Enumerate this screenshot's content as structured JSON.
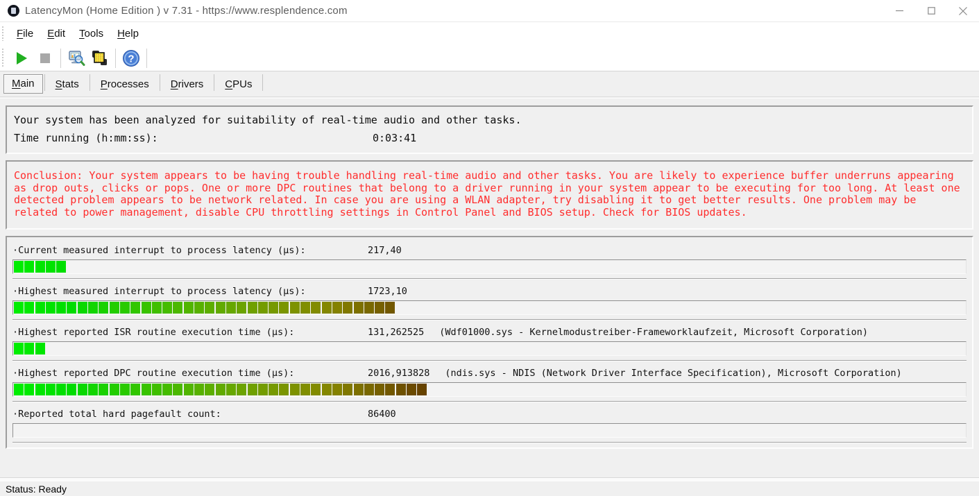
{
  "window": {
    "title": "LatencyMon  (Home Edition )  v 7.31 - https://www.resplendence.com",
    "controls": {
      "minimize": "minimize",
      "maximize": "maximize",
      "close": "close"
    }
  },
  "menu": {
    "items": [
      "File",
      "Edit",
      "Tools",
      "Help"
    ]
  },
  "toolbar": {
    "icons": [
      "play-icon",
      "stop-icon",
      "system-report-icon",
      "layered-windows-icon",
      "help-icon"
    ]
  },
  "tabs": {
    "items": [
      "Main",
      "Stats",
      "Processes",
      "Drivers",
      "CPUs"
    ],
    "active": "Main"
  },
  "analysis": {
    "headline": "Your system has been analyzed for suitability of real-time audio and other tasks.",
    "time_label": "Time running (h:mm:ss):",
    "time_value": "0:03:41"
  },
  "conclusion": "Conclusion: Your system appears to be having trouble handling real-time audio and other tasks. You are likely to experience buffer underruns appearing as drop outs, clicks or pops. One or more DPC routines that belong to a driver running in your system appear to be executing for too long. At least one detected problem appears to be network related. In case you are using a WLAN adapter, try disabling it to get better results. One problem may be related to power management, disable CPU throttling settings in Control Panel and BIOS setup. Check for BIOS updates.",
  "measurements": [
    {
      "label": "·Current measured interrupt to process latency (µs):",
      "value": "217,40",
      "extra": "",
      "segments": 5
    },
    {
      "label": "·Highest measured interrupt to process latency (µs):",
      "value": "1723,10",
      "extra": "",
      "segments": 36
    },
    {
      "label": "·Highest reported ISR routine execution time (µs):",
      "value": "131,262525",
      "extra": "(Wdf01000.sys - Kernelmodustreiber-Frameworklaufzeit, Microsoft Corporation)",
      "segments": 3
    },
    {
      "label": "·Highest reported DPC routine execution time (µs):",
      "value": "2016,913828",
      "extra": "(ndis.sys - NDIS (Network Driver Interface Specification), Microsoft Corporation)",
      "segments": 39
    },
    {
      "label": "·Reported total hard pagefault count:",
      "value": "86400",
      "extra": "",
      "segments": 0
    }
  ],
  "status": "Status: Ready",
  "colors": {
    "conclusion_text": "#ff2d2d",
    "bar_green_start": "#00ed00",
    "bar_brown_end": "#674300",
    "play_button": "#21b021"
  }
}
